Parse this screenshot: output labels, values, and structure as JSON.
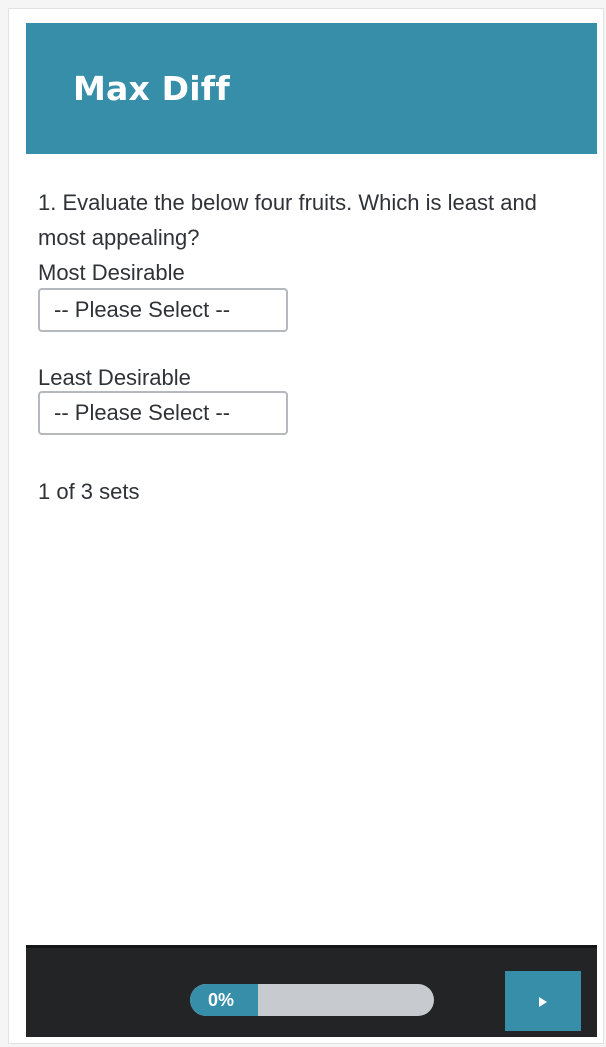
{
  "header": {
    "title": "Max Diff"
  },
  "question": {
    "text": "1. Evaluate the below four fruits. Which is least and most appealing?"
  },
  "fields": {
    "most": {
      "label": "Most Desirable",
      "selected": "-- Please Select --"
    },
    "least": {
      "label": "Least Desirable",
      "selected": "-- Please Select --"
    }
  },
  "status": {
    "sets": "1 of 3 sets"
  },
  "footer": {
    "progress_text": "0%",
    "progress_fraction": 0.0,
    "next_icon": "play-triangle-icon"
  },
  "colors": {
    "accent": "#368ea9",
    "footer_bg": "#222426",
    "progress_track": "#c7cbd0"
  }
}
